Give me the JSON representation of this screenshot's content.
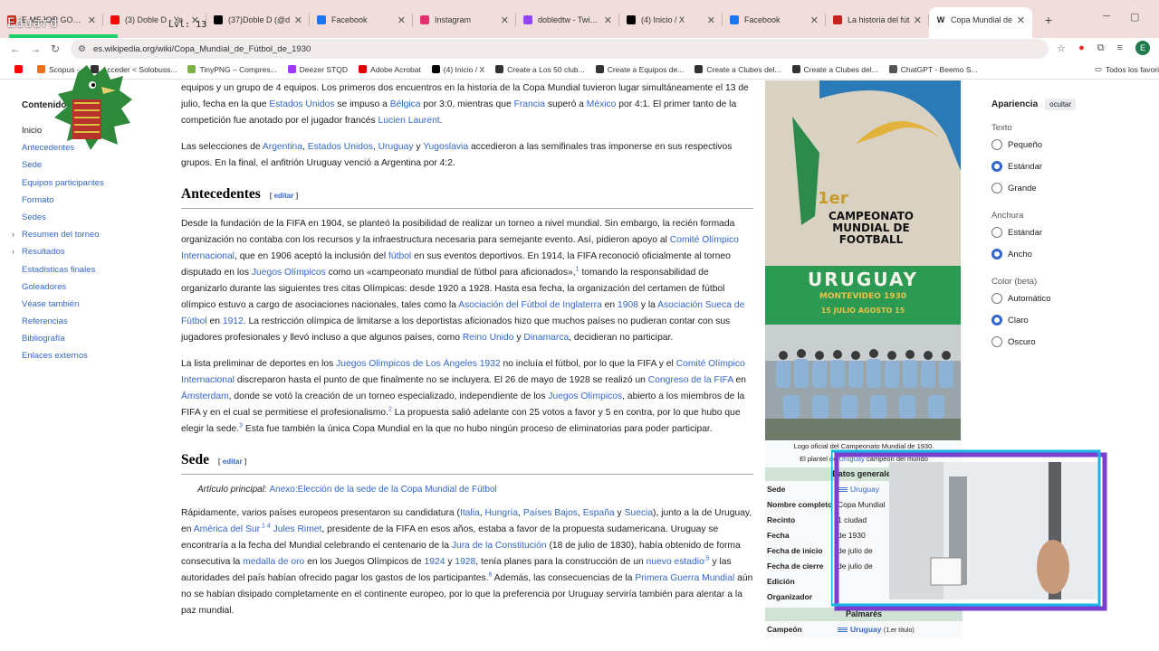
{
  "browser": {
    "tabs": [
      {
        "title": "Ε MEJOR GOL de",
        "icon_color": "#d93025",
        "icon": "play-icon"
      },
      {
        "title": "(3) Doble D - Yo",
        "icon_color": "#ff0000",
        "icon": "youtube-icon"
      },
      {
        "title": "(37)Doble D (@d",
        "icon_color": "#000000",
        "icon": "tiktok-icon"
      },
      {
        "title": "Facebook",
        "icon_color": "#1877f2",
        "icon": "facebook-icon"
      },
      {
        "title": "Instagram",
        "icon_color": "#e1306c",
        "icon": "instagram-icon"
      },
      {
        "title": "dobledtw - Twitch",
        "icon_color": "#9146ff",
        "icon": "twitch-icon"
      },
      {
        "title": "(4) Inicio / X",
        "icon_color": "#000000",
        "icon": "x-icon"
      },
      {
        "title": "Facebook",
        "icon_color": "#1877f2",
        "icon": "facebook-icon"
      },
      {
        "title": "La historia del fút",
        "icon_color": "#c5221f",
        "icon": "bookmark-icon"
      },
      {
        "title": "Copa Mundial de",
        "icon_color": "#202122",
        "icon": "wikipedia-icon"
      }
    ],
    "close_glyph": "✕",
    "new_tab": "+",
    "url": "es.wikipedia.org/wiki/Copa_Mundial_de_Fútbol_de_1930",
    "avatar_letter": "E",
    "bookmarks": [
      {
        "label": "",
        "color": "#ff0000"
      },
      {
        "label": "Scopus -",
        "color": "#e9711c"
      },
      {
        "label": "Acceder < Solobuss...",
        "color": "#333333"
      },
      {
        "label": "TinyPNG – Compres...",
        "color": "#7cb342"
      },
      {
        "label": "Deezer STQD",
        "color": "#a238ff"
      },
      {
        "label": "Adobe Acrobat",
        "color": "#e00000"
      },
      {
        "label": "(4) Inicio / X",
        "color": "#000000"
      },
      {
        "label": "Create a Los 50 club...",
        "color": "#333333"
      },
      {
        "label": "Create a Equipos de...",
        "color": "#333333"
      },
      {
        "label": "Create a Clubes del...",
        "color": "#333333"
      },
      {
        "label": "Create a Clubes del...",
        "color": "#333333"
      },
      {
        "label": "ChatGPT - Beemo S...",
        "color": "#555555"
      }
    ],
    "all_bookmarks": "Todos los favori"
  },
  "overlay": {
    "name": "Eduard",
    "level": "Lvl: 13"
  },
  "toc": {
    "title": "Contenidos",
    "items": [
      {
        "label": "Inicio",
        "expandable": false
      },
      {
        "label": "Antecedentes",
        "expandable": false
      },
      {
        "label": "Sede",
        "expandable": false
      },
      {
        "label": "Equipos participantes",
        "expandable": false
      },
      {
        "label": "Formato",
        "expandable": false
      },
      {
        "label": "Sedes",
        "expandable": false
      },
      {
        "label": "Resumen del torneo",
        "expandable": true
      },
      {
        "label": "Resultados",
        "expandable": true
      },
      {
        "label": "Estadísticas finales",
        "expandable": false
      },
      {
        "label": "Goleadores",
        "expandable": false
      },
      {
        "label": "Véase también",
        "expandable": false
      },
      {
        "label": "Referencias",
        "expandable": false
      },
      {
        "label": "Bibliografía",
        "expandable": false
      },
      {
        "label": "Enlaces externos",
        "expandable": false
      }
    ]
  },
  "article": {
    "intro": {
      "p1_top": "equipos y un grupo de 4 equipos. Los primeros dos encuentros en la historia de la Copa Mundial tuvieron lugar simultáneamente el 13 de julio, fecha en la que",
      "estados_unidos": "Estados Unidos",
      "p1_a": "se impuso a",
      "belgica": "Bélgica",
      "p1_b": "por 3:0, mientras que",
      "francia": "Francia",
      "p1_c": "superó a",
      "mexico": "México",
      "p1_d": "por 4:1. El primer tanto de la competición fue anotado por el jugador francés",
      "laurent": "Lucien Laurent",
      "p1_end": ".",
      "p2_a": "Las selecciones de",
      "argentina": "Argentina",
      "comma1": ",",
      "estados_unidos2": "Estados Unidos",
      "comma2": ",",
      "uruguay": "Uruguay",
      "y1": "y",
      "yugoslavia": "Yugoslavia",
      "p2_b": "accedieron a las semifinales tras imponerse en sus respectivos grupos. En la final, el anfitrión Uruguay venció a Argentina por 4:2."
    },
    "antecedentes": {
      "title": "Antecedentes",
      "edit": "editar",
      "p1_a": "Desde la fundación de la FIFA en 1904, se planteó la posibilidad de realizar un torneo a nivel mundial. Sin embargo, la recién formada organización no contaba con los recursos y la infraestructura necesaria para semejante evento. Así, pidieron apoyo al",
      "coi": "Comité Olímpico Internacional",
      "p1_b": ", que en 1906 aceptó la inclusión del",
      "futbol": "fútbol",
      "p1_c": "en sus eventos deportivos. En 1914, la FIFA reconoció oficialmente al torneo disputado en los",
      "jjoo": "Juegos Olímpicos",
      "p1_d": "como un «campeonato mundial de fútbol para aficionados»,",
      "ref1": "1",
      "p1_e": "tomando la responsabilidad de organizarlo durante las siguientes tres citas Olímpicas: desde 1920 a 1928. Hasta esa fecha, la organización del certamen de fútbol olímpico estuvo a cargo de asociaciones nacionales, tales como la",
      "afi": "Asociación del Fútbol de Inglaterra",
      "en1": "en",
      "y1908": "1908",
      "y_la": "y la",
      "asf": "Asociación Sueca de Fútbol",
      "en2": "en",
      "y1912": "1912",
      "p1_f": ". La restricción olímpica de limitarse a los deportistas aficionados hizo que muchos países no pudieran contar con sus jugadores profesionales y llevó incluso a que algunos países, como",
      "reino_unido": "Reino Unido",
      "y2": "y",
      "dinamarca": "Dinamarca",
      "p1_g": ", decidieran no participar.",
      "p2_a": "La lista preliminar de deportes en los",
      "jjoo1932": "Juegos Olímpicos de Los Ángeles 1932",
      "p2_b": "no incluía el fútbol, por lo que la FIFA y el",
      "coi2": "Comité Olímpico Internacional",
      "p2_c": "discreparon hasta el punto de que finalmente no se incluyera. El 26 de mayo de 1928 se realizó un",
      "congreso": "Congreso de la FIFA",
      "en3": "en",
      "amsterdam": "Ámsterdam",
      "p2_d": ", donde se votó la creación de un torneo especializado, independiente de los",
      "jjoo2": "Juegos Olímpicos",
      "p2_e": ", abierto a los miembros de la FIFA y en el cual se permitiese el profesionalismo.",
      "ref2": "2",
      "p2_f": "La propuesta salió adelante con 25 votos a favor y 5 en contra, por lo que hubo que elegir la sede.",
      "ref3": "3",
      "p2_g": "Esta fue también la única Copa Mundial en la que no hubo ningún proceso de eliminatorias para poder participar."
    },
    "sede": {
      "title": "Sede",
      "edit": "editar",
      "hatnote_label": "Artículo principal:",
      "hatnote_link": "Anexo:Elección de la sede de la Copa Mundial de Fútbol",
      "p1_a": "Rápidamente, varios países europeos presentaron su candidatura (",
      "italia": "Italia",
      "c1": ",",
      "hungria": "Hungría",
      "c2": ",",
      "paises_bajos": "Países Bajos",
      "c3": ",",
      "espana": "España",
      "y1": "y",
      "suecia": "Suecia",
      "p1_b": "), junto a la de Uruguay, en",
      "america_sur": "América del Sur",
      "ref14": ".1 4",
      "rimet": "Jules Rimet",
      "p1_c": ", presidente de la FIFA en esos años, estaba a favor de la propuesta sudamericana. Uruguay se encontraría a la fecha del Mundial celebrando el centenario de la",
      "jura": "Jura de la Constitución",
      "p1_d": "(18 de julio de 1830), había obtenido de forma consecutiva la",
      "medalla": "medalla de oro",
      "p1_e": "en los Juegos Olímpicos de",
      "y1924": "1924",
      "y2": "y",
      "y1928": "1928",
      "p1_f": ", tenía planes para la construcción de un",
      "estadio": "nuevo estadio",
      "ref5": ",5",
      "p1_g": "y las autoridades del país habían ofrecido pagar los gastos de los participantes.",
      "ref6": "6",
      "p1_h": "Además, las consecuencias de la",
      "guerra": "Primera Guerra Mundial",
      "p1_i": "aún no se habían disipado completamente en el continente europeo, por lo que la preferencia por Uruguay serviría también para alentar a la paz mundial."
    }
  },
  "infobox": {
    "poster_text": [
      "1er",
      "CAMPEONATO",
      "MUNDIAL DE",
      "FOOTBALL",
      "URUGUAY",
      "MONTEVIDEO",
      "1930",
      "15 JULIO AGOSTO 15"
    ],
    "caption1": "Logo oficial del Campeonato Mundial de 1930.",
    "caption2_a": "El plantel de",
    "caption2_link": "Uruguay",
    "caption2_b": "campeón del mundo",
    "datos_header": "Datos generales",
    "rows": [
      {
        "k": "Sede",
        "v": "Uruguay",
        "flag": true,
        "link": true
      },
      {
        "k": "Nombre completo",
        "v": "Copa Mundial",
        "flag": false,
        "link": false
      },
      {
        "k": "Recinto",
        "v": "1 ciudad",
        "flag": false,
        "link": false
      },
      {
        "k": "Fecha",
        "v": "de 1930",
        "flag": false,
        "link": false
      },
      {
        "k": "Fecha de inicio",
        "v": "de julio de",
        "flag": false,
        "link": false
      },
      {
        "k": "Fecha de cierre",
        "v": "de julio de",
        "flag": false,
        "link": false
      },
      {
        "k": "Edición",
        "v": "",
        "flag": false,
        "link": false
      },
      {
        "k": "Organizador",
        "v": "",
        "flag": false,
        "link": false
      }
    ],
    "palmares_header": "Palmarés",
    "campeon_k": "Campeón",
    "campeon_v": "Uruguay",
    "campeon_note": "(1.er título)"
  },
  "appearance": {
    "title": "Apariencia",
    "hide": "ocultar",
    "groups": [
      {
        "label": "Texto",
        "options": [
          {
            "label": "Pequeño",
            "on": false
          },
          {
            "label": "Estándar",
            "on": true
          },
          {
            "label": "Grande",
            "on": false
          }
        ]
      },
      {
        "label": "Anchura",
        "options": [
          {
            "label": "Estándar",
            "on": false
          },
          {
            "label": "Ancho",
            "on": true
          }
        ]
      },
      {
        "label": "Color (beta)",
        "options": [
          {
            "label": "Automático",
            "on": false
          },
          {
            "label": "Claro",
            "on": true
          },
          {
            "label": "Oscuro",
            "on": false
          }
        ]
      }
    ]
  }
}
